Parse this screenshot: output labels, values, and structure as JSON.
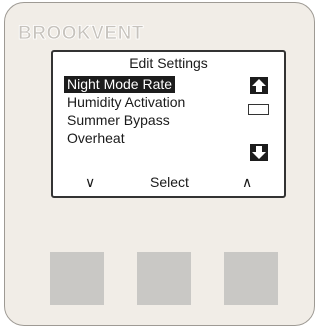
{
  "brand": {
    "logo_text": "BROOKVENT"
  },
  "screen": {
    "title": "Edit Settings",
    "menu_items": [
      {
        "label": "Night Mode Rate",
        "selected": true
      },
      {
        "label": "Humidity Activation",
        "selected": false
      },
      {
        "label": "Summer Bypass",
        "selected": false
      },
      {
        "label": "Overheat",
        "selected": false
      }
    ],
    "softkeys": {
      "left": "∨",
      "center": "Select",
      "right": "∧"
    }
  },
  "colors": {
    "panel": "#f1ede7",
    "button": "#c9c8c5",
    "highlight": "#1c1c1c",
    "logo": "#c7c3bd"
  }
}
